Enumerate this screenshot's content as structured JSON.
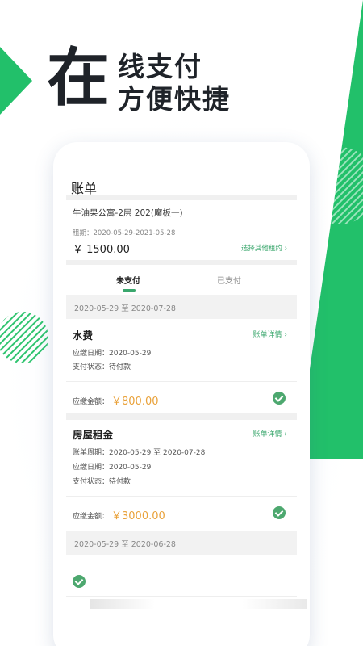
{
  "hero": {
    "big_char": "在",
    "line1": "线支付",
    "line2": "方便快捷"
  },
  "colors": {
    "brand_green": "#22c06a",
    "accent_green": "#3aa76d",
    "amount_orange": "#e9a23b",
    "text_dark": "#1f2329"
  },
  "page": {
    "title": "账单"
  },
  "contract": {
    "name": "牛油果公寓-2层 202(魔板一)",
    "period": "租期：2020-05-29-2021-05-28",
    "amount": "￥ 1500.00",
    "other_link": "选择其他租约 ›"
  },
  "tabs": {
    "unpaid": "未支付",
    "paid": "已支付"
  },
  "sections": [
    {
      "date_range": "2020-05-29 至 2020-07-28"
    },
    {
      "date_range": "2020-05-29 至 2020-06-28"
    }
  ],
  "bills": [
    {
      "title": "水费",
      "detail_link": "账单详情 ›",
      "lines": [
        "应缴日期：2020-05-29",
        "支付状态：待付款"
      ],
      "amount_label": "应缴金额：",
      "amount": "￥800.00"
    },
    {
      "title": "房屋租金",
      "detail_link": "账单详情 ›",
      "lines": [
        "账单周期：2020-05-29 至 2020-07-28",
        "应缴日期：2020-05-29",
        "支付状态：待付款"
      ],
      "amount_label": "应缴金额：",
      "amount": "￥3000.00"
    }
  ],
  "icons": [
    "check-icon",
    "chevron-right-icon"
  ]
}
